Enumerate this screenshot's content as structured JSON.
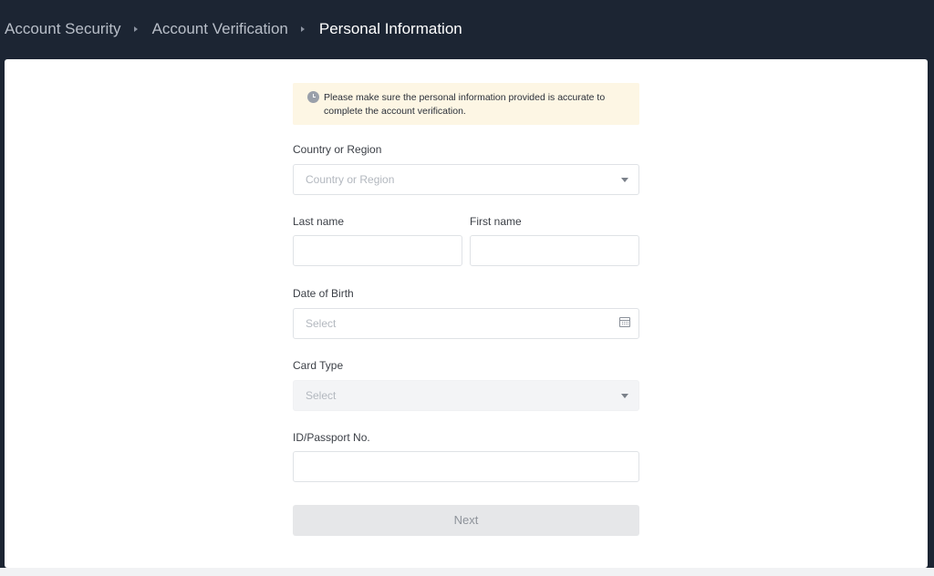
{
  "breadcrumb": [
    {
      "label": "Account Security"
    },
    {
      "label": "Account Verification"
    },
    {
      "label": "Personal Information"
    }
  ],
  "notice": {
    "icon": "clock-icon",
    "text": "Please make sure the personal information provided is accurate to complete the account verification."
  },
  "form": {
    "country": {
      "label": "Country or Region",
      "placeholder": "Country or Region"
    },
    "last_name": {
      "label": "Last name",
      "value": ""
    },
    "first_name": {
      "label": "First name",
      "value": ""
    },
    "dob": {
      "label": "Date of Birth",
      "placeholder": "Select",
      "icon": "calendar-icon"
    },
    "card_type": {
      "label": "Card Type",
      "placeholder": "Select",
      "disabled": true
    },
    "id_number": {
      "label": "ID/Passport No.",
      "value": ""
    },
    "next_label": "Next"
  },
  "colors": {
    "header_bg": "#1c2533",
    "notice_bg": "#fdf6e4",
    "button_disabled_bg": "#e6e7e9"
  }
}
